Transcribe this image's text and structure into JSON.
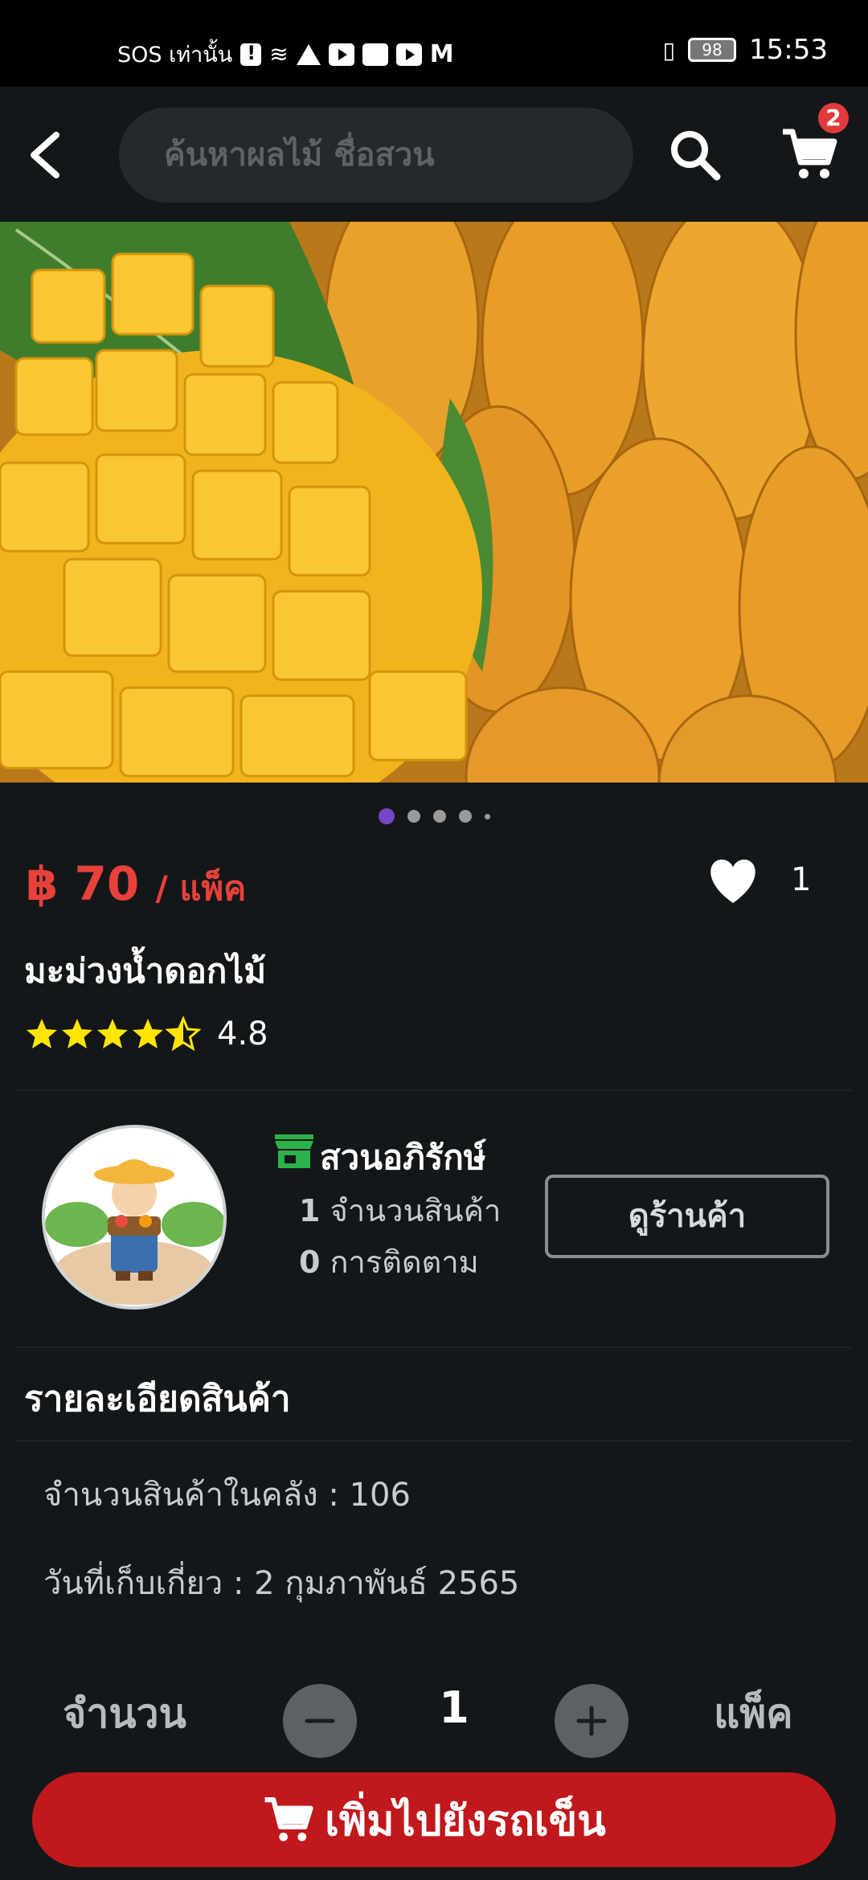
{
  "status_bar": {
    "carrier": "SOS เท่านั้น",
    "battery": "98",
    "time": "15:53"
  },
  "header": {
    "search_placeholder": "ค้นหาผลไม้ ชื่อสวน",
    "cart_count": "2"
  },
  "gallery": {
    "image_count": 4,
    "active_index": 0
  },
  "product": {
    "price": "฿ 70",
    "price_unit": "/ แพ็ค",
    "like_count": "1",
    "name": "มะม่วงน้ำดอกไม้",
    "rating": "4.8",
    "rating_value": 4.8
  },
  "shop": {
    "name": "สวนอภิรักษ์",
    "product_count": "1",
    "product_count_label": "จำนวนสินค้า",
    "followers": "0",
    "followers_label": "การติดตาม",
    "view_button": "ดูร้านค้า"
  },
  "details": {
    "section_title": "รายละเอียดสินค้า",
    "stock": "จำนวนสินค้าในคลัง : 106",
    "harvest_date": "วันที่เก็บเกี่ยว : 2 กุมภาพันธ์ 2565"
  },
  "purchase": {
    "qty_label": "จำนวน",
    "qty_value": "1",
    "unit": "แพ็ค",
    "add_to_cart": "เพิ่มไปยังรถเข็น"
  },
  "colors": {
    "price": "#e8413b",
    "accent_purple": "#7645c8",
    "add_button": "#c0181c",
    "shop_icon": "#2bb34b",
    "star": "#ffe500"
  }
}
